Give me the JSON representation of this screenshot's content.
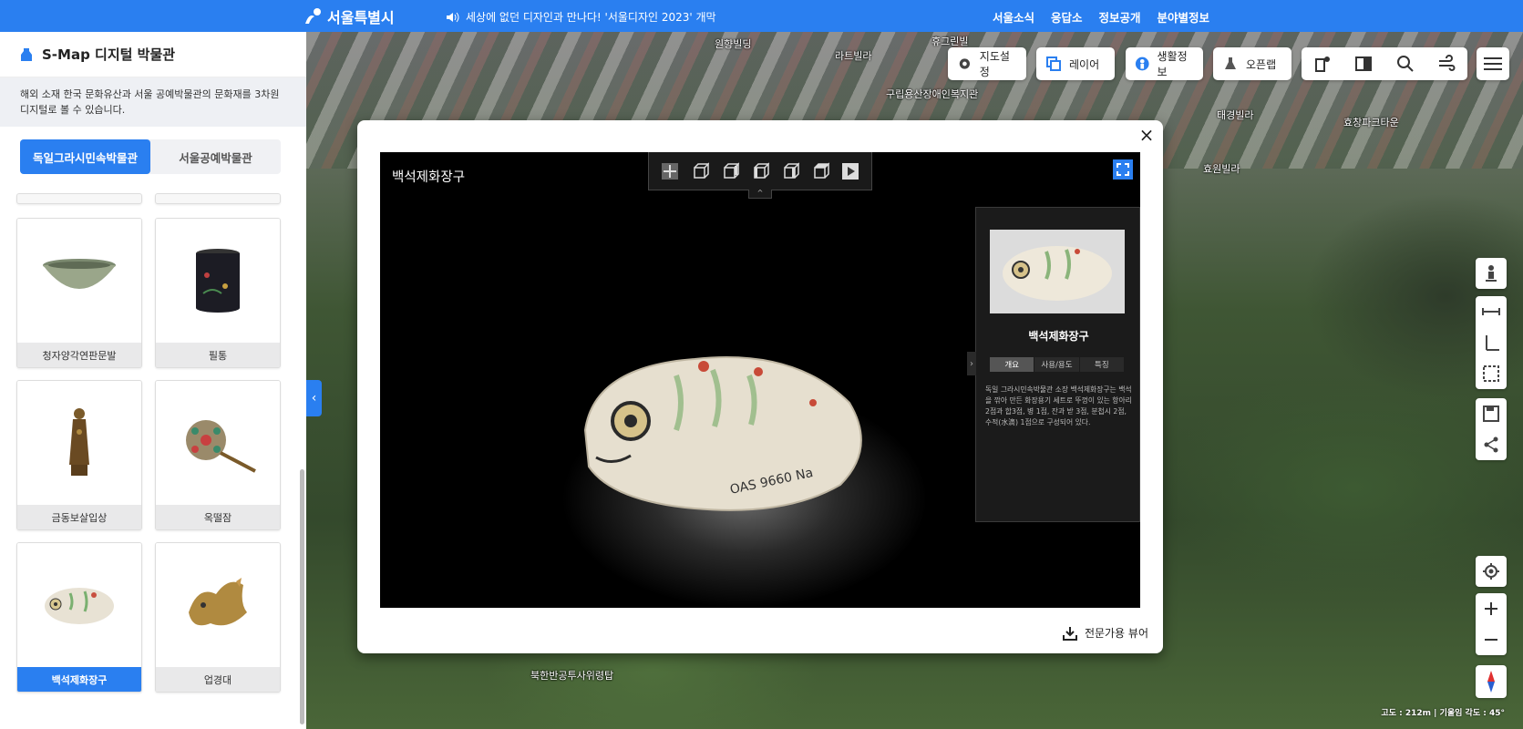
{
  "topbar": {
    "logo_text": "서울특별시",
    "notice": "세상에 없던 디자인과 만나다! '서울디자인 2023' 개막",
    "nav": [
      "서울소식",
      "응답소",
      "정보공개",
      "분야별정보"
    ]
  },
  "sidebar": {
    "title": "S-Map 디지털 박물관",
    "description": "해외 소재 한국 문화유산과 서울 공예박물관의 문화재를 3차원 디지털로 볼 수 있습니다.",
    "tabs": [
      {
        "label": "독일그라시민속박물관",
        "active": true
      },
      {
        "label": "서울공예박물관",
        "active": false
      }
    ],
    "items": [
      {
        "label": "청자양각연판문발",
        "icon": "celadon-bowl"
      },
      {
        "label": "필통",
        "icon": "brush-holder"
      },
      {
        "label": "금동보살입상",
        "icon": "bodhisattva-statue"
      },
      {
        "label": "옥떨잠",
        "icon": "jeweled-hairpin"
      },
      {
        "label": "백석제화장구",
        "icon": "fish-cosmetic-case",
        "selected": true
      },
      {
        "label": "업경대",
        "icon": "mirror-stand-figure"
      }
    ]
  },
  "map_labels": [
    "원향빌딩",
    "라트빌라",
    "휴그린빌",
    "구립용산장애인복지관",
    "태경빌라",
    "효창파크타운",
    "효원빌라",
    "북한반공투사위령탑"
  ],
  "toolbar": {
    "map_settings": "지도설정",
    "layers": "레이어",
    "life_info": "생활정보",
    "open_lab": "오픈랩"
  },
  "status_text": "고도 : 212m | 기울임 각도 : 45°",
  "modal": {
    "viewer_title": "백석제화장구",
    "info": {
      "name": "백석제화장구",
      "tabs": [
        {
          "label": "개요",
          "active": true
        },
        {
          "label": "사용/용도",
          "active": false
        },
        {
          "label": "특징",
          "active": false
        }
      ],
      "text": "독일 그라시민속박물관 소장 백석제화장구는 백석을 깎아 만든 화장용기 세트로 뚜껑이 있는 항아리 2점과 합3점, 병 1점, 잔과 받 3점, 분첩시 2점, 수적(水滴) 1점으로 구성되어 있다."
    },
    "download_label": "전문가용 뷰어"
  },
  "colors": {
    "brand": "#2a7ff0"
  }
}
